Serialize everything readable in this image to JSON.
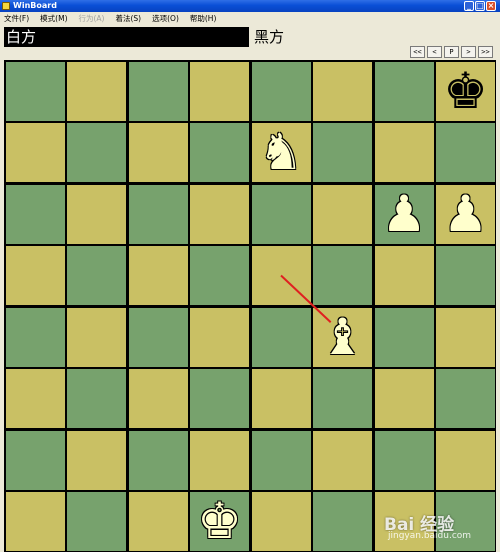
{
  "window": {
    "title": "WinBoard",
    "controls": {
      "minimize": "_",
      "maximize": "□",
      "close": "×"
    }
  },
  "menu": {
    "items": [
      {
        "label": "文件(F)",
        "disabled": false
      },
      {
        "label": "模式(M)",
        "disabled": false
      },
      {
        "label": "行为(A)",
        "disabled": true
      },
      {
        "label": "着法(S)",
        "disabled": false
      },
      {
        "label": "选项(O)",
        "disabled": false
      },
      {
        "label": "帮助(H)",
        "disabled": false
      }
    ]
  },
  "players": {
    "white": "白方",
    "black": "黑方"
  },
  "nav": {
    "first": "<<",
    "back": "<",
    "pause": "P",
    "forward": ">",
    "last": ">>"
  },
  "board": {
    "light_color": "#C9C064",
    "dark_color": "#77A26D",
    "pieces": [
      {
        "square": "h8",
        "type": "king",
        "color": "black",
        "glyph": "♚"
      },
      {
        "square": "e7",
        "type": "knight",
        "color": "white",
        "glyph": "♞"
      },
      {
        "square": "g6",
        "type": "pawn",
        "color": "white",
        "glyph": "♟"
      },
      {
        "square": "h6",
        "type": "pawn",
        "color": "white",
        "glyph": "♟"
      },
      {
        "square": "f4",
        "type": "bishop",
        "color": "white",
        "glyph": "♝"
      },
      {
        "square": "d1",
        "type": "king",
        "color": "white",
        "glyph": "♚"
      }
    ],
    "last_move": {
      "from": "e5",
      "to": "f4",
      "color": "#E02020"
    }
  },
  "watermark": {
    "text": "Bai 经验",
    "sub": "jingyan.baidu.com"
  }
}
